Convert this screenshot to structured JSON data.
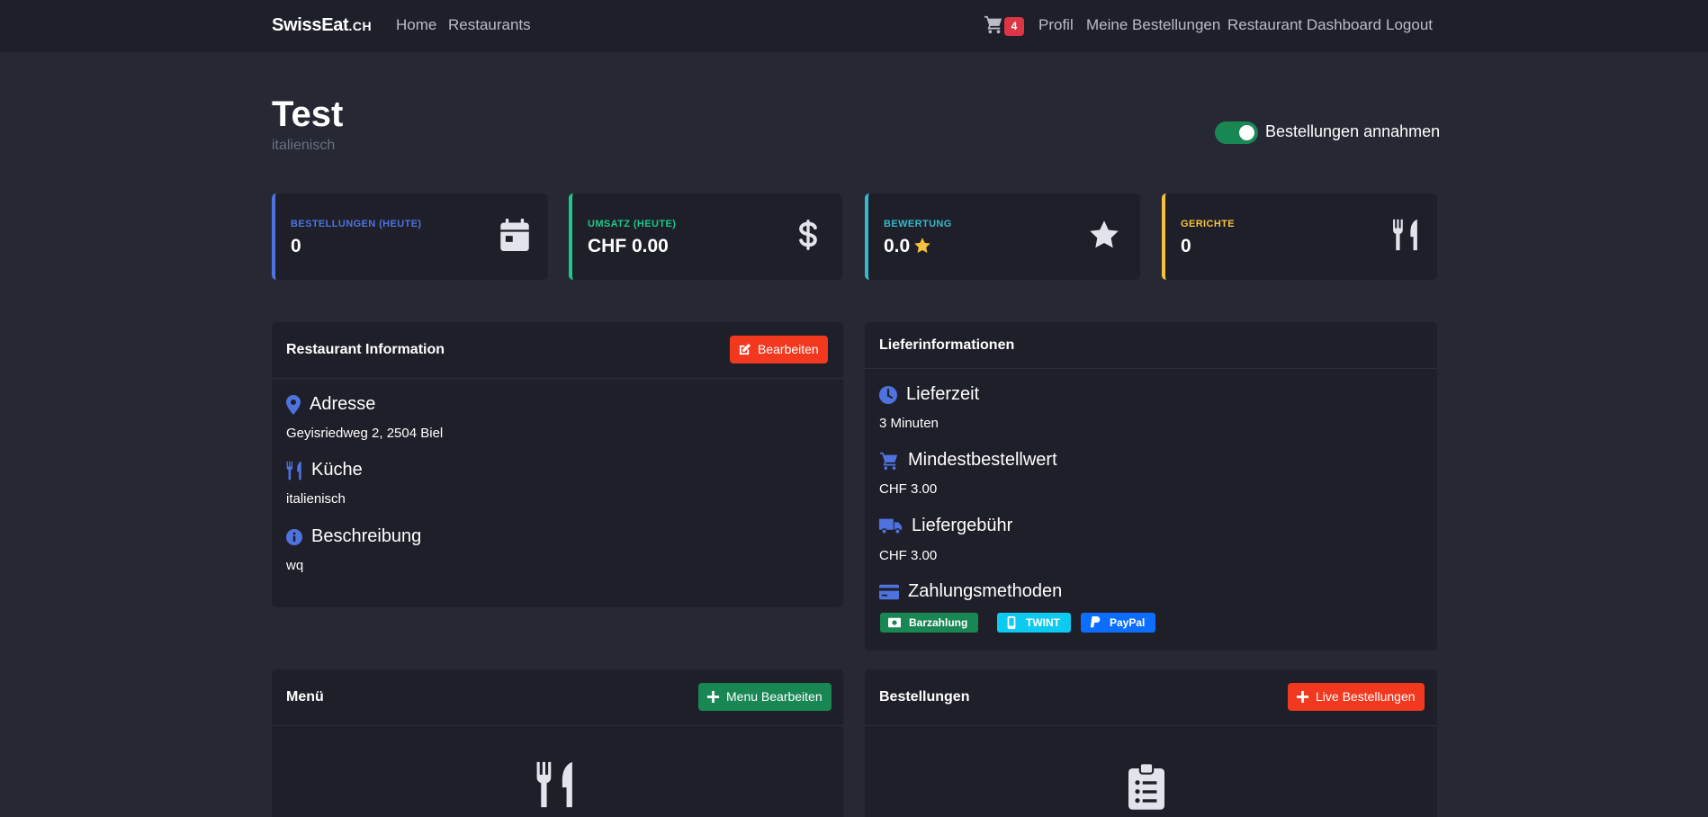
{
  "navbar": {
    "brand_main": "SwissEat",
    "brand_suffix": ".CH",
    "links": [
      "Home",
      "Restaurants"
    ],
    "cart_icon": "cart-icon",
    "cart_count": "4",
    "right_links": [
      "Profil",
      "Meine Bestellungen",
      "Restaurant Dashboard",
      "Logout"
    ]
  },
  "header": {
    "title": "Test",
    "subtitle": "italienisch",
    "toggle_label": "Bestellungen annahmen",
    "toggle_on": true
  },
  "stats": [
    {
      "label": "BESTELLUNGEN (HEUTE)",
      "value": "0",
      "icon": "calendar-icon",
      "color": "#4e73df"
    },
    {
      "label": "UMSATZ (HEUTE)",
      "value": "CHF 0.00",
      "icon": "dollar-icon",
      "color": "#1cc88a"
    },
    {
      "label": "BEWERTUNG",
      "value": "0.0",
      "icon": "star-icon",
      "color": "#36b9cc"
    },
    {
      "label": "GERICHTE",
      "value": "0",
      "icon": "utensils-icon",
      "color": "#f6c23e"
    }
  ],
  "restaurant_info": {
    "title": "Restaurant Information",
    "edit_label": "Bearbeiten",
    "address_heading": "Adresse",
    "address": "Geyisriedweg 2, 2504 Biel",
    "cuisine_heading": "Küche",
    "cuisine": "italienisch",
    "description_heading": "Beschreibung",
    "description": "wq"
  },
  "delivery_info": {
    "title": "Lieferinformationen",
    "time_heading": "Lieferzeit",
    "time": "3 Minuten",
    "min_order_heading": "Mindestbestellwert",
    "min_order": "CHF 3.00",
    "fee_heading": "Liefergebühr",
    "fee": "CHF 3.00",
    "payment_heading": "Zahlungsmethoden",
    "payment_methods": [
      "Barzahlung",
      "TWINT",
      "PayPal"
    ]
  },
  "menu_panel": {
    "title": "Menü",
    "button_label": "Menu Bearbeiten"
  },
  "orders_panel": {
    "title": "Bestellungen",
    "button_label": "Live Bestellungen"
  },
  "colors": {
    "background": "#262833",
    "surface": "#1e1f29",
    "accent_blue": "#4e73df",
    "danger": "#f2391f",
    "success": "#198754"
  }
}
